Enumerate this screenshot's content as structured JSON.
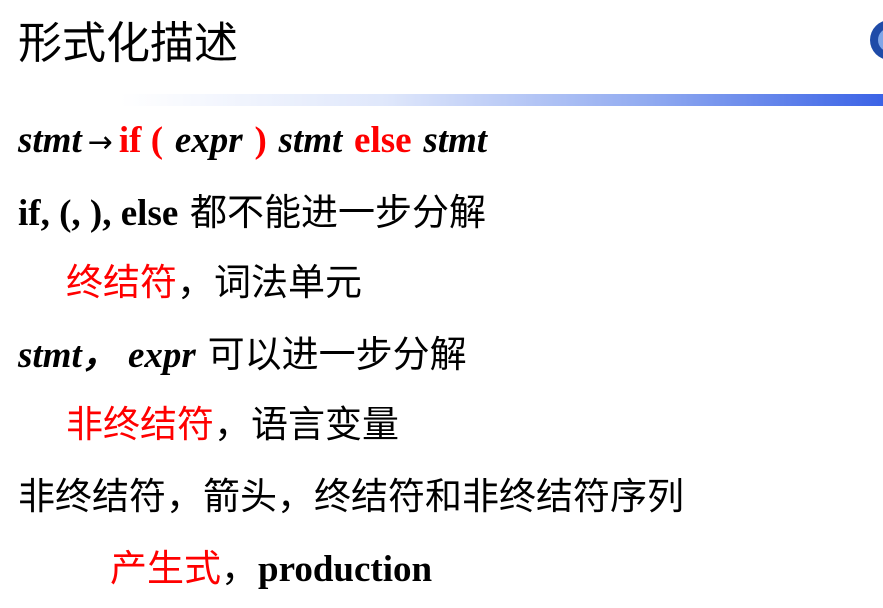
{
  "slide": {
    "title": "形式化描述",
    "line1": {
      "lhs": "stmt",
      "arrow": "→",
      "kw_if": "if (",
      "expr": "expr",
      "close": ")",
      "stmt1": "stmt",
      "kw_else": "else",
      "stmt2": "stmt"
    },
    "line2": {
      "tokens": "if, (, ), else",
      "text": "都不能进一步分解"
    },
    "line3": {
      "term": "终结符",
      "rest": "，词法单元"
    },
    "line4": {
      "vars": "stmt， expr",
      "text": "可以进一步分解"
    },
    "line5": {
      "term": "非终结符",
      "rest": "，语言变量"
    },
    "line6": {
      "text": "非终结符，箭头，终结符和非终结符序列"
    },
    "line7": {
      "term": "产生式",
      "sep": "，",
      "en": "production"
    }
  },
  "colors": {
    "accent": "#ff0000",
    "bar": "#3b63e6"
  },
  "icons": {
    "logo": "university-logo-icon"
  }
}
